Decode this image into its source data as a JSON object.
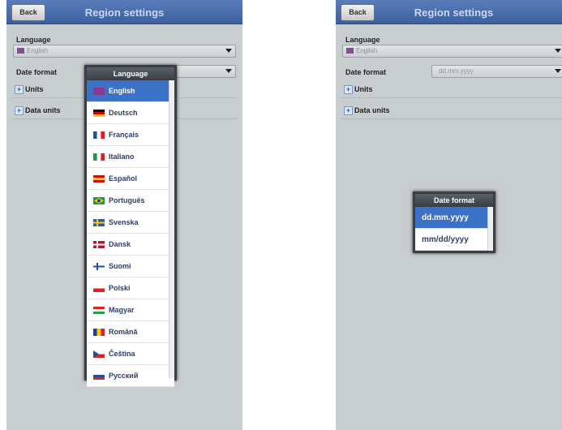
{
  "left": {
    "title": "Region settings",
    "back": "Back",
    "language_label": "Language",
    "language_value": "English",
    "date_label": "Date format",
    "units": "Units",
    "data_units": "Data units",
    "popup_title": "Language",
    "options": [
      {
        "label": "English",
        "flag": "uk",
        "selected": true
      },
      {
        "label": "Deutsch",
        "flag": "de"
      },
      {
        "label": "Français",
        "flag": "fr"
      },
      {
        "label": "Italiano",
        "flag": "it"
      },
      {
        "label": "Español",
        "flag": "es"
      },
      {
        "label": "Português",
        "flag": "br"
      },
      {
        "label": "Svenska",
        "flag": "se"
      },
      {
        "label": "Dansk",
        "flag": "dk"
      },
      {
        "label": "Suomi",
        "flag": "fi"
      },
      {
        "label": "Polski",
        "flag": "pl"
      },
      {
        "label": "Magyar",
        "flag": "hu"
      },
      {
        "label": "Română",
        "flag": "ro"
      },
      {
        "label": "Čeština",
        "flag": "cz"
      },
      {
        "label": "Русский",
        "flag": "ru"
      }
    ]
  },
  "right": {
    "title": "Region settings",
    "back": "Back",
    "language_label": "Language",
    "language_value": "English",
    "date_label": "Date format",
    "date_value": "dd.mm.yyyy",
    "units": "Units",
    "data_units": "Data units",
    "popup_title": "Date format",
    "options": [
      {
        "label": "dd.mm.yyyy",
        "selected": true
      },
      {
        "label": "mm/dd/yyyy"
      }
    ]
  }
}
